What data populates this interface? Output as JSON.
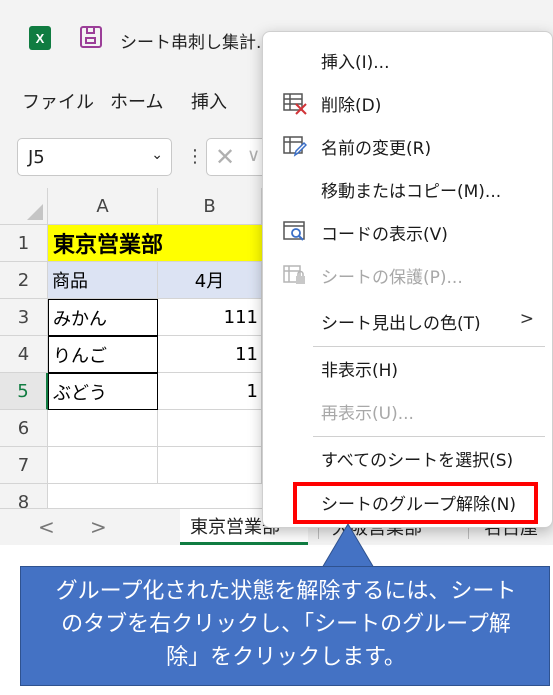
{
  "app": {
    "icon_letter": "X",
    "doc_title": "シート串刺し集計.…"
  },
  "menubar": {
    "items": [
      "ファイル",
      "ホーム",
      "挿入"
    ]
  },
  "formula_bar": {
    "name_box_value": "J5",
    "chevron": "⌄",
    "kebab": "⋮",
    "cancel_glyph": "✕",
    "confirm_glyph": "∨"
  },
  "grid": {
    "columns": [
      "A",
      "B"
    ],
    "rows": [
      "1",
      "2",
      "3",
      "4",
      "5",
      "6",
      "7",
      "8"
    ],
    "title": "東京営業部",
    "header": {
      "a": "商品",
      "b": "4月"
    },
    "data": [
      {
        "a": "みかん",
        "b": "111"
      },
      {
        "a": "りんご",
        "b": "11"
      },
      {
        "a": "ぶどう",
        "b": "1"
      }
    ],
    "selected_row": "5",
    "colors": {
      "title_fill": "#ffff00",
      "header_fill": "#dce3f3",
      "accent": "#107c41"
    }
  },
  "tabs": {
    "prev_arrow": "<",
    "next_arrow": ">",
    "items": [
      "東京営業部",
      "大阪営業部",
      "名古屋"
    ],
    "active": "東京営業部"
  },
  "context_menu": {
    "items": [
      {
        "label": "挿入(I)...",
        "icon": "none",
        "disabled": false
      },
      {
        "label": "削除(D)",
        "icon": "delete-sheet-icon",
        "disabled": false
      },
      {
        "label": "名前の変更(R)",
        "icon": "rename-sheet-icon",
        "disabled": false
      },
      {
        "label": "移動またはコピー(M)...",
        "icon": "none",
        "disabled": false
      },
      {
        "label": "コードの表示(V)",
        "icon": "view-code-icon",
        "disabled": false
      },
      {
        "label": "シートの保護(P)...",
        "icon": "protect-sheet-icon",
        "disabled": true
      },
      {
        "label": "シート見出しの色(T)",
        "icon": "none",
        "disabled": false,
        "submenu_arrow": ">"
      },
      {
        "label": "非表示(H)",
        "icon": "none",
        "disabled": false
      },
      {
        "label": "再表示(U)...",
        "icon": "none",
        "disabled": true
      },
      {
        "label": "すべてのシートを選択(S)",
        "icon": "none",
        "disabled": false
      },
      {
        "label": "シートのグループ解除(N)",
        "icon": "none",
        "disabled": false
      }
    ],
    "highlight_color": "#ff0000"
  },
  "callout": {
    "text": "グループ化された状態を解除するには、シートのタブを右クリックし、「シートのグループ解除」をクリックします。",
    "fill": "#4472c4"
  }
}
